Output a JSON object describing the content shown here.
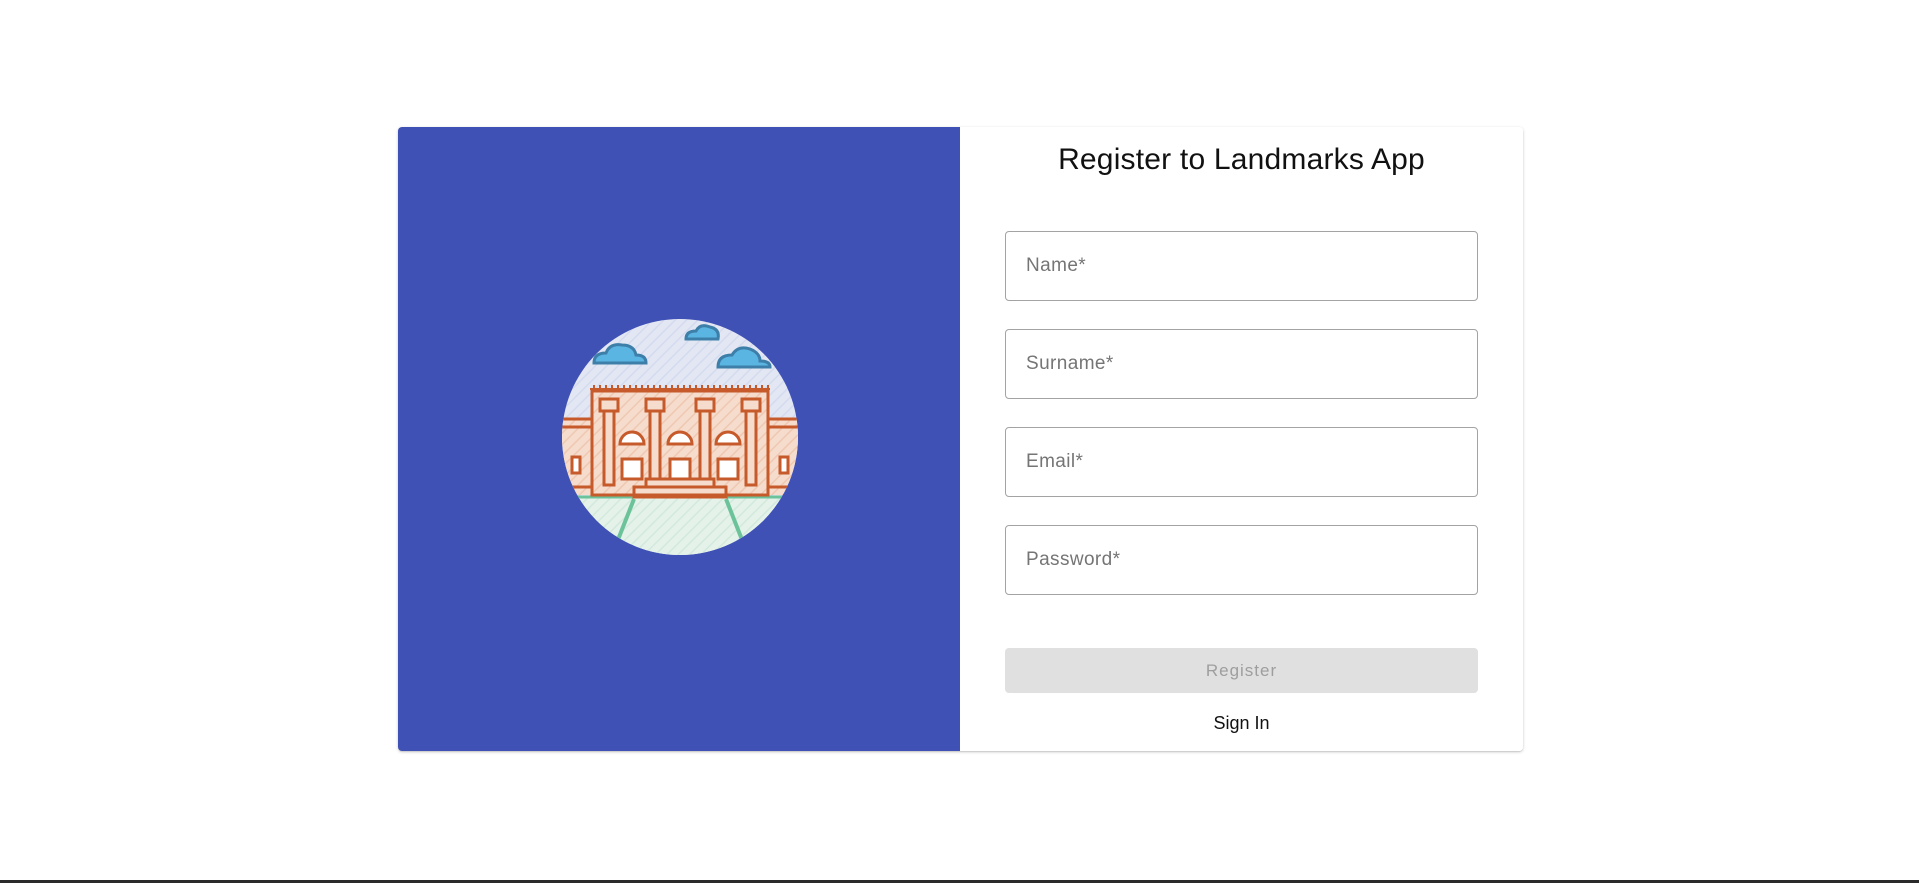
{
  "form": {
    "title": "Register to Landmarks App",
    "fields": {
      "name": {
        "placeholder": "Name*",
        "value": ""
      },
      "surname": {
        "placeholder": "Surname*",
        "value": ""
      },
      "email": {
        "placeholder": "Email*",
        "value": ""
      },
      "password": {
        "placeholder": "Password*",
        "value": ""
      }
    },
    "register_label": "Register",
    "signin_label": "Sign In"
  },
  "hero": {
    "illustration_icon": "landmark-building-icon",
    "background_color": "#3f51b5"
  },
  "colors": {
    "register_disabled_bg": "#e0e0e0",
    "register_disabled_text": "#9e9e9e",
    "field_border": "#a3a3a3"
  }
}
